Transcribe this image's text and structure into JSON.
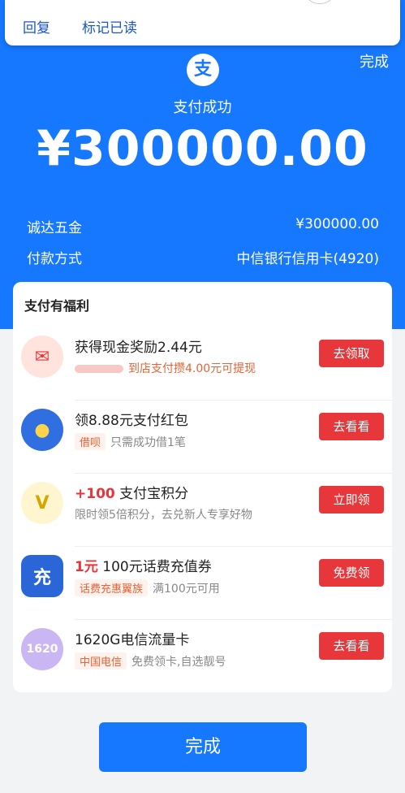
{
  "notification": {
    "reply": "回复",
    "mark_read": "标记已读"
  },
  "header": {
    "done_label": "完成",
    "logo_char": "支",
    "status": "支付成功",
    "amount": "¥300000.00"
  },
  "payment_info": {
    "merchant_label": "诚达五金",
    "merchant_amount": "¥300000.00",
    "method_label": "付款方式",
    "method_value": "中信银行信用卡(4920)"
  },
  "benefits": {
    "title": "支付有福利",
    "items": [
      {
        "icon": "red-envelope-icon",
        "title_highlight": "",
        "title": "获得现金奖励2.44元",
        "tag": "",
        "sub": "到店支付攒4.00元可提现",
        "button": "去领取"
      },
      {
        "icon": "chick-mascot-icon",
        "title_highlight": "",
        "title": "领8.88元支付红包",
        "tag": "借呗",
        "sub": "只需成功借1笔",
        "button": "去看看"
      },
      {
        "icon": "coin-icon",
        "title_highlight": "+100",
        "title": " 支付宝积分",
        "tag": "",
        "sub": "限时领5倍积分，去兑新人专享好物",
        "button": "立即领"
      },
      {
        "icon": "phone-recharge-icon",
        "title_highlight": "1元",
        "title": " 100元话费充值券",
        "tag": "话费充惠翼族",
        "sub": "满100元可用",
        "button": "免费领"
      },
      {
        "icon": "data-card-icon",
        "title_highlight": "",
        "title": "1620G电信流量卡",
        "tag": "中国电信",
        "sub": "免费领卡,自选靓号",
        "button": "去看看"
      }
    ]
  },
  "footer": {
    "done_button": "完成"
  },
  "colors": {
    "brand_blue": "#1677ff",
    "action_red": "#e8373b"
  }
}
